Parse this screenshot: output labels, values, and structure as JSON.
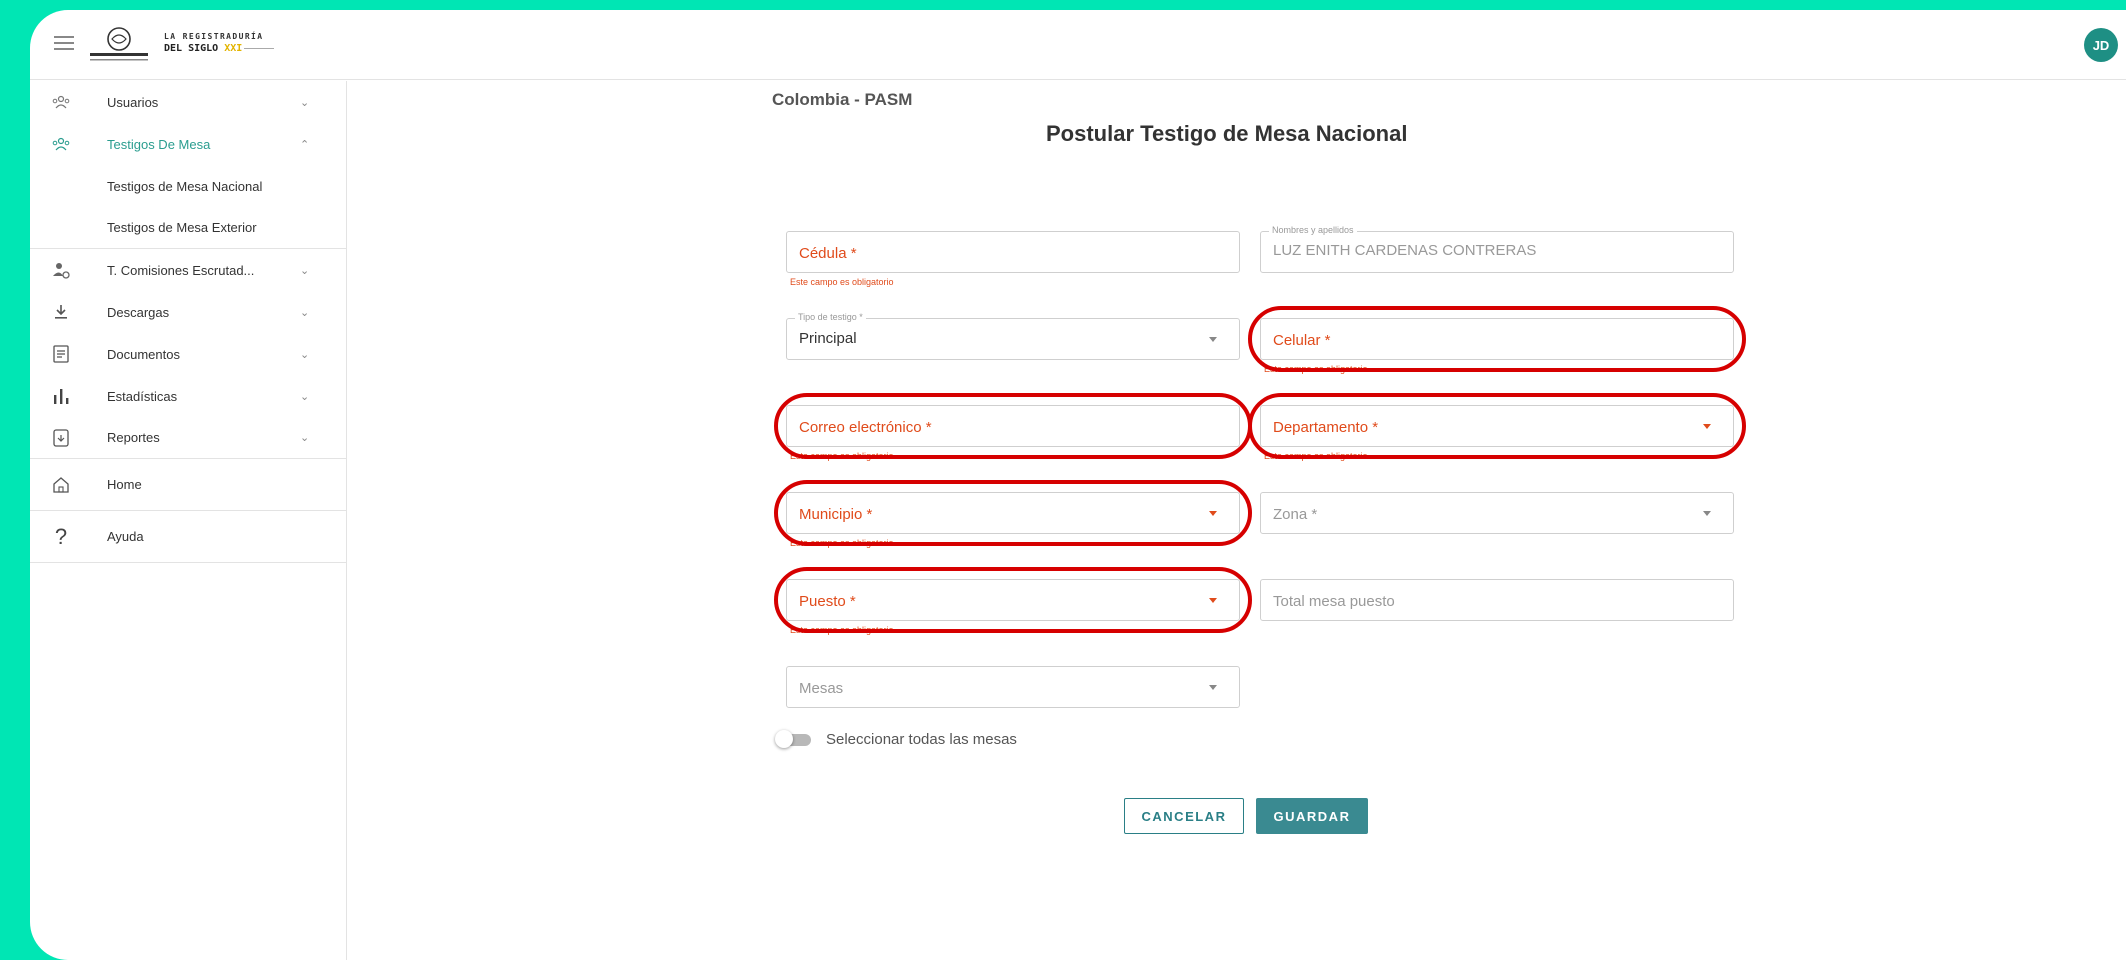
{
  "app": {
    "logo": {
      "line1": "LA REGISTRADURÍA",
      "line2": "DEL SIGLO",
      "line2_accent": "XXI",
      "seal_text": "REGISTRADURÍA"
    },
    "user_initials": "JD"
  },
  "sidebar": {
    "items": [
      {
        "label": "Usuarios",
        "icon": "users-icon"
      },
      {
        "label": "Testigos De Mesa",
        "icon": "users-icon"
      },
      {
        "label": "T. Comisiones Escrutad...",
        "icon": "person-settings-icon"
      },
      {
        "label": "Descargas",
        "icon": "download-icon"
      },
      {
        "label": "Documentos",
        "icon": "document-icon"
      },
      {
        "label": "Estadísticas",
        "icon": "bar-chart-icon"
      },
      {
        "label": "Reportes",
        "icon": "report-icon"
      },
      {
        "label": "Home",
        "icon": "home-icon"
      },
      {
        "label": "Ayuda",
        "icon": "help-icon"
      }
    ],
    "subitems": [
      {
        "label": "Testigos de Mesa Nacional"
      },
      {
        "label": "Testigos de Mesa Exterior"
      }
    ]
  },
  "form": {
    "country": "Colombia - PASM",
    "title": "Postular Testigo de Mesa Nacional",
    "cedula": {
      "placeholder": "Cédula *",
      "error": "Este campo es obligatorio"
    },
    "nombres": {
      "label": "Nombres y apellidos",
      "value": "LUZ ENITH CARDENAS CONTRERAS"
    },
    "tipo_testigo": {
      "label": "Tipo de testigo *",
      "value": "Principal"
    },
    "celular": {
      "placeholder": "Celular *",
      "error": "Este campo es obligatorio"
    },
    "correo": {
      "placeholder": "Correo electrónico *",
      "error": "Este campo es obligatorio"
    },
    "departamento": {
      "placeholder": "Departamento *",
      "error": "Este campo es obligatorio"
    },
    "municipio": {
      "placeholder": "Municipio *",
      "error": "Este campo es obligatorio"
    },
    "zona": {
      "placeholder": "Zona *"
    },
    "puesto": {
      "placeholder": "Puesto *",
      "error": "Este campo es obligatorio"
    },
    "total_mesa": {
      "placeholder": "Total mesa puesto"
    },
    "mesas": {
      "placeholder": "Mesas"
    },
    "select_all_label": "Seleccionar todas las mesas",
    "cancel_label": "CANCELAR",
    "save_label": "GUARDAR"
  },
  "colors": {
    "background": "#00e6b4",
    "accent": "#2a9d8f",
    "error": "#e04b1b",
    "highlight_ring": "#d60000",
    "primary_button": "#3a8a91"
  }
}
